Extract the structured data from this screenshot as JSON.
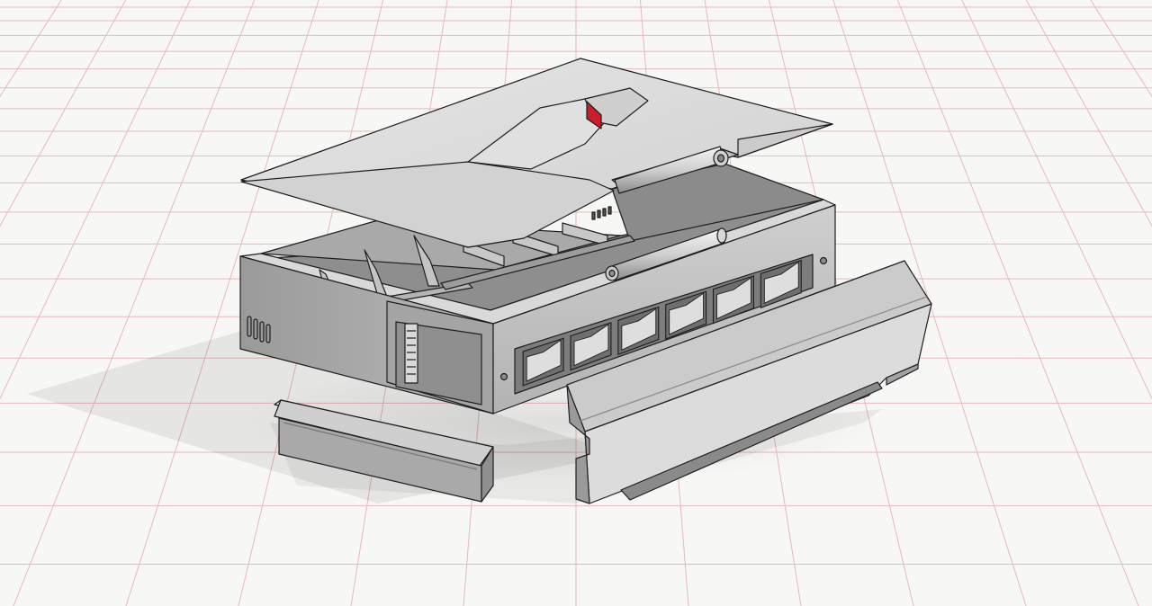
{
  "viewport": {
    "background": "#f7f7f5",
    "grid_color": "#e9b8bc",
    "accent_red": "#c8202a",
    "model_light": "#dadada",
    "model_mid": "#b9b9b9",
    "model_dark": "#8a8a8a",
    "edge_color": "#1e1e1e"
  },
  "scene": {
    "parts": [
      "lid",
      "base-enclosure",
      "hinge-pin",
      "front-bezel",
      "side-rail"
    ],
    "hinge_count": 2,
    "port_openings": 6,
    "grid": "perspective-ground-grid"
  }
}
